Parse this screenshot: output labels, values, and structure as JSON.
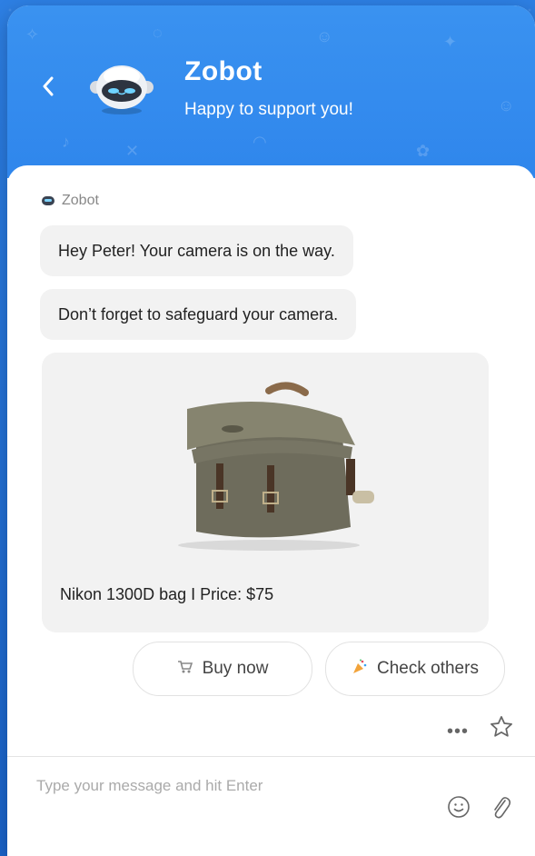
{
  "header": {
    "back_icon": "chevron-left-icon",
    "bot_name": "Zobot",
    "bot_subtitle": "Happy to support you!"
  },
  "conversation": {
    "sender": "Zobot",
    "messages": [
      "Hey Peter! Your camera is on the way.",
      "Don’t forget to safeguard your camera."
    ],
    "product_card": {
      "caption": "Nikon 1300D bag I Price: $75",
      "image_icon": "camera-bag-image"
    },
    "actions": [
      {
        "icon": "cart-icon",
        "label": "Buy now"
      },
      {
        "icon": "party-popper-icon",
        "label": "Check others"
      }
    ],
    "more_icon": "more-dots-icon",
    "star_icon": "star-icon"
  },
  "composer": {
    "placeholder": "Type your message and hit Enter",
    "emoji_icon": "smiley-icon",
    "attach_icon": "paperclip-icon"
  },
  "colors": {
    "header_blue": "#3a92f0",
    "page_blue": "#1d6fd6",
    "bubble_gray": "#f2f2f2"
  }
}
